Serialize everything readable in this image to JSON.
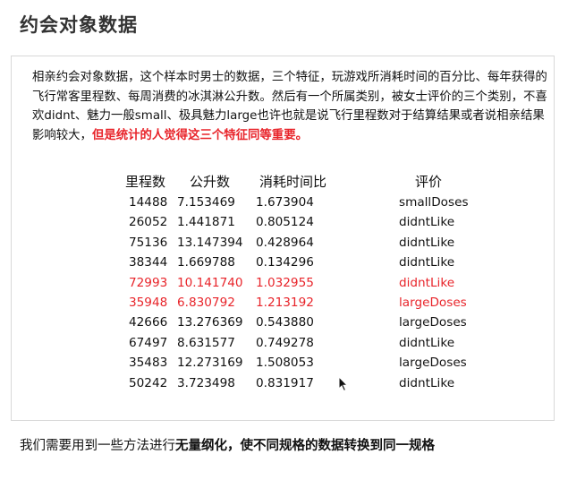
{
  "title": "约会对象数据",
  "paragraph": {
    "normal": "相亲约会对象数据，这个样本时男士的数据，三个特征，玩游戏所消耗时间的百分比、每年获得的飞行常客里程数、每周消费的冰淇淋公升数。然后有一个所属类别，被女士评价的三个类别，不喜欢didnt、魅力一般small、极具魅力large也许也就是说飞行里程数对于结算结果或者说相亲结果影响较大，",
    "highlight": "但是统计的人觉得这三个特征同等重要。"
  },
  "table": {
    "headers": [
      "里程数",
      "公升数",
      "消耗时间比",
      "评价"
    ],
    "rows": [
      {
        "miles": "14488",
        "liters": "7.153469",
        "ratio": "1.673904",
        "rating": "smallDoses",
        "highlight": false
      },
      {
        "miles": "26052",
        "liters": "1.441871",
        "ratio": "0.805124",
        "rating": "didntLike",
        "highlight": false
      },
      {
        "miles": "75136",
        "liters": "13.147394",
        "ratio": "0.428964",
        "rating": "didntLike",
        "highlight": false
      },
      {
        "miles": "38344",
        "liters": "1.669788",
        "ratio": "0.134296",
        "rating": "didntLike",
        "highlight": false
      },
      {
        "miles": "72993",
        "liters": "10.141740",
        "ratio": "1.032955",
        "rating": "didntLike",
        "highlight": true
      },
      {
        "miles": "35948",
        "liters": "6.830792",
        "ratio": "1.213192",
        "rating": "largeDoses",
        "highlight": true
      },
      {
        "miles": "42666",
        "liters": "13.276369",
        "ratio": "0.543880",
        "rating": "largeDoses",
        "highlight": false
      },
      {
        "miles": "67497",
        "liters": "8.631577",
        "ratio": "0.749278",
        "rating": "didntLike",
        "highlight": false
      },
      {
        "miles": "35483",
        "liters": "12.273169",
        "ratio": "1.508053",
        "rating": "largeDoses",
        "highlight": false
      },
      {
        "miles": "50242",
        "liters": "3.723498",
        "ratio": "0.831917",
        "rating": "didntLike",
        "highlight": false
      }
    ]
  },
  "bottom": {
    "prefix": "我们需要用到一些方法进行",
    "bold": "无量纲化，使不同规格的数据转换到同一规格"
  },
  "colors": {
    "highlight": "#e8242a"
  },
  "icons": {
    "cursor": "mouse-pointer-icon"
  }
}
